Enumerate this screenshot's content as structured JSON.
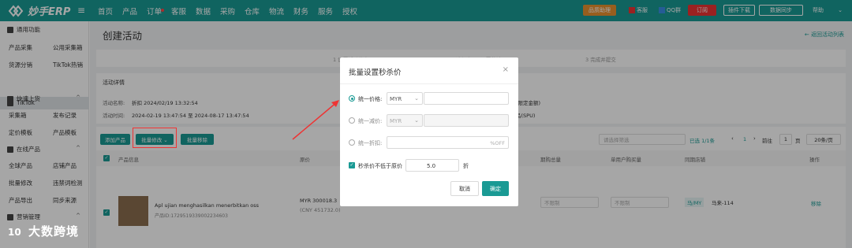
{
  "app": {
    "name": "妙手ERP"
  },
  "nav": [
    "首页",
    "产品",
    "订单",
    "客服",
    "数据",
    "采购",
    "仓库",
    "物流",
    "财务",
    "服务",
    "授权"
  ],
  "topright": {
    "promo": "品质助理",
    "kefu": "客服",
    "qq": "QQ群",
    "subscribe": "订阅",
    "plugin": "插件下载",
    "sync": "数据同步",
    "help": "帮助"
  },
  "sidebar": {
    "common": "通用功能",
    "items1": [
      "产品采集",
      "公用采集箱",
      "货源分销",
      "TikTok热销"
    ],
    "tiktok": "TikTok",
    "quick": "快速上货",
    "items2": [
      "采集箱",
      "发布记录",
      "定价模板",
      "产品模板"
    ],
    "online": "在线产品",
    "items3": [
      "全球产品",
      "店铺产品",
      "批量修改",
      "违禁词检测",
      "产品导出",
      "同步来源"
    ],
    "marketing": "营销管理"
  },
  "page": {
    "title": "创建活动",
    "back": "← 返回活动列表",
    "steps": [
      "1  设置活动信息",
      "2  选择产品&设置秒杀价",
      "3  完成并提交"
    ],
    "section": "活动详情",
    "name_label": "活动名称:",
    "name_value": "折扣 2024/02/19 13:32:54",
    "time_label": "活动时间:",
    "time_value": "2024-02-19 13:47:54 至 2024-08-17 13:47:54",
    "right_info1": "(限定金额)",
    "right_info2": "品(SPU)"
  },
  "toolbar": {
    "add": "添加产品",
    "batch_edit": "批量修改 ⌄",
    "batch_remove": "批量移除",
    "filter_placeholder": "请选择筛选",
    "selected": "已选 1/1条",
    "page": "1",
    "goto_label": "前往",
    "goto_value": "1",
    "page_unit": "页",
    "page_size": "20条/页"
  },
  "table": {
    "headers": [
      "产品信息",
      "原价",
      "期购总量",
      "单用户购买量",
      "同期店铺",
      "操作"
    ],
    "row": {
      "name": "Apl ujian menghasilkan menerbitkan oss",
      "id": "产品ID:1729519339002234603",
      "price": "MYR 300018.3",
      "price2": "(CNY 451732.0)",
      "qty": "不限制",
      "user_qty": "不限制",
      "store": "马/MY",
      "store_name": "马来-114",
      "action": "移除"
    }
  },
  "modal": {
    "title": "批量设置秒杀价",
    "close": "×",
    "opt1": "统一价格:",
    "opt1_currency": "MYR",
    "opt2": "统一减价:",
    "opt2_currency": "MYR",
    "opt3": "统一折扣:",
    "opt3_suffix": "%OFF",
    "check_label": "秒杀价不低于原价",
    "check_value": "5.0",
    "check_unit": "折",
    "cancel": "取消",
    "ok": "确定"
  },
  "watermark": "大数跨境",
  "colors": {
    "brand": "#1a9a94",
    "accent": "#e33"
  }
}
